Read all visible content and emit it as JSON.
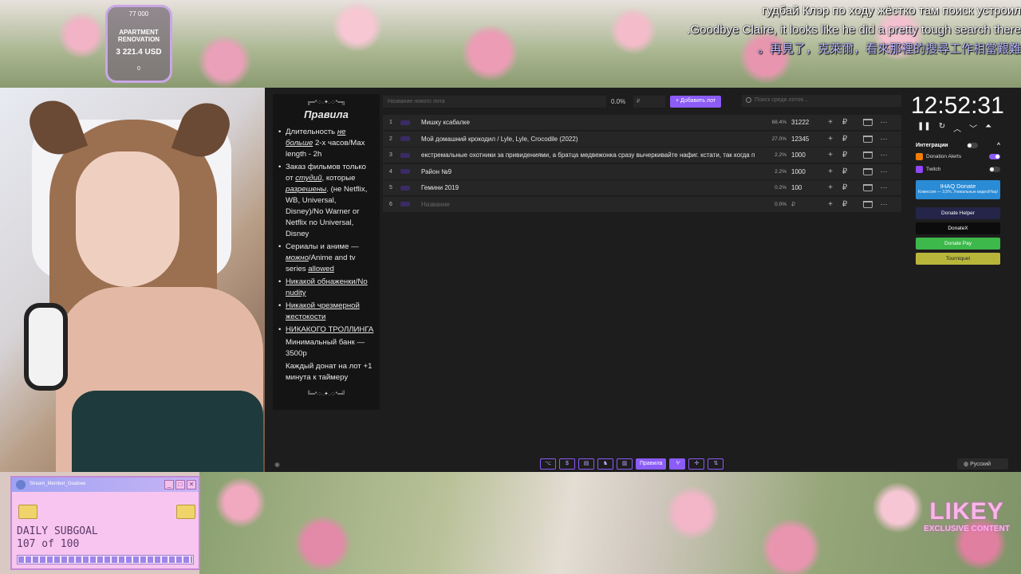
{
  "goal": {
    "top_value": "77 000",
    "name": "APARTMENT RENOVATION",
    "amount": "3 221.4 USD",
    "bottom_value": "0"
  },
  "subtitles": {
    "ru": "гудбай Клэр по ходу жёстко там поиск устроил",
    "en": ".Goodbye Claire, it looks like he did a pretty tough search there",
    "zh": "。再見了，克萊爾，看來那裡的搜尋工作相當艱難"
  },
  "subgoal": {
    "title": "Stream_Member_Goalsee",
    "label": "DAILY SUBGOAL",
    "progress_text": "107 of 100",
    "progress": 1.0,
    "window_buttons": [
      "_",
      "□",
      "✕"
    ]
  },
  "likey": {
    "logo": "LIKEY",
    "sub": "EXCLUSIVE CONTENT"
  },
  "rules": {
    "deco_top": "╔═*·:·.✦.·:·*═╗",
    "title": "Правила",
    "items": [
      {
        "pre": "Длительность ",
        "em": "не больше",
        "post": " 2-х часов/Max length - 2h"
      },
      {
        "pre": "Заказ фильмов только от ",
        "em": "студий",
        "post": ", которые "
      },
      {
        "em2": "разрешены",
        "post2": ". (не Netflix, WB, Universal, Disney)/No Warner or Netflix no Universal, Disney"
      },
      {
        "pre": "Сериалы и аниме — ",
        "em": "можно",
        "post": "/Anime and tv series ",
        "u": "allowed"
      },
      {
        "u": "Никакой обнаженки/No nudity"
      },
      {
        "u": "Никакой чрезмерной жестокости"
      },
      {
        "u": "НИКАКОГО ТРОЛЛИНГА"
      }
    ],
    "plain": [
      "Минимальный банк — 3500р",
      "Каждый донат на лот +1 минута к таймеру"
    ],
    "deco_bottom": "╚═*·:·.✦.·:·*═╝"
  },
  "lot_bar": {
    "name_placeholder": "Название нового лота",
    "percent": "0.0%",
    "amount_placeholder": "₽",
    "add_button": "+ Добавить лот",
    "search_placeholder": "Поиск среди лотов..."
  },
  "lots": [
    {
      "idx": "1",
      "title": "Мишку ксабалке",
      "pct": "68.4%",
      "sum": "31222"
    },
    {
      "idx": "2",
      "title": "Мой домашний крокодил / Lyle, Lyle, Crocodile (2022)",
      "pct": "27.0%",
      "sum": "12345"
    },
    {
      "idx": "3",
      "title": "екстремальные охотники за привидениями, а братца медвежонка сразу вычеркивайте нафиг. кстати, так когда п",
      "pct": "2.2%",
      "sum": "1000"
    },
    {
      "idx": "4",
      "title": "Район №9",
      "pct": "2.2%",
      "sum": "1000"
    },
    {
      "idx": "5",
      "title": "Гемини 2019",
      "pct": "0.2%",
      "sum": "100"
    },
    {
      "idx": "6",
      "title": "Название",
      "pct": "0.0%",
      "sum": "₽"
    }
  ],
  "lot_actions": {
    "plus": "+",
    "currency": "₽",
    "more": "⋯"
  },
  "timer": {
    "time": "12:52:31",
    "controls": [
      "❚❚",
      "↻",
      "︿",
      "﹀",
      "⏶"
    ]
  },
  "integrations": {
    "title": "Интеграции",
    "collapse": "^",
    "items": [
      {
        "name": "Donation Alerts",
        "color": "#f57d07",
        "on": true
      },
      {
        "name": "Twitch",
        "color": "#9146ff",
        "on": false
      }
    ],
    "ihaq_title": "IHAQ Donate",
    "ihaq_sub": "Комиссия — 3,5%. Уникальные видеоIHaq!",
    "donate_helper": "Donate Helper",
    "donatex": "DonateX",
    "donate_pay": "Donate Pay",
    "tourniquet": "Tourniquet"
  },
  "toolbar": {
    "buttons": [
      "⌥",
      "$",
      "▤",
      "♞",
      "▥"
    ],
    "rules_button": "Правила",
    "after": [
      "⅟",
      "✢",
      "⇅"
    ]
  },
  "language": "Русский",
  "colors": {
    "accent": "#8b5cf6",
    "panel": "#1d1d1d",
    "row": "#262626"
  }
}
